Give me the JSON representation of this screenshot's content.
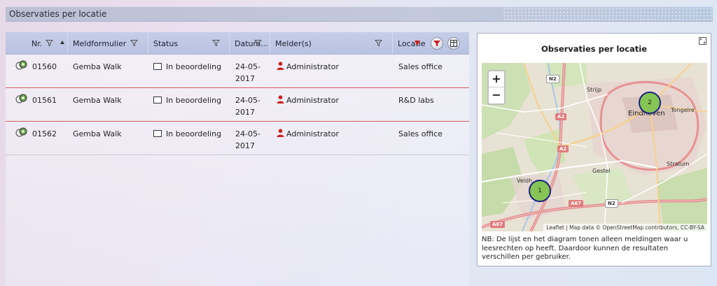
{
  "page": {
    "title": "Observaties per locatie"
  },
  "grid": {
    "columns": {
      "nr": "Nr.",
      "meldformulier": "Meldformulier",
      "status": "Status",
      "datum": "Datum...",
      "melders": "Melder(s)",
      "locatie": "Locatie"
    },
    "rows": [
      {
        "nr": "01560",
        "form": "Gemba Walk",
        "status": "In beoordeling",
        "date1": "24-05-",
        "date2": "2017",
        "reporter": "Administrator",
        "location": "Sales office"
      },
      {
        "nr": "01561",
        "form": "Gemba Walk",
        "status": "In beoordeling",
        "date1": "24-05-",
        "date2": "2017",
        "reporter": "Administrator",
        "location": "R&D labs"
      },
      {
        "nr": "01562",
        "form": "Gemba Walk",
        "status": "In beoordeling",
        "date1": "24-05-",
        "date2": "2017",
        "reporter": "Administrator",
        "location": "Sales office"
      }
    ]
  },
  "panel": {
    "title": "Observaties per locatie",
    "zoom_in": "+",
    "zoom_out": "−",
    "clusters": [
      {
        "count": "2"
      },
      {
        "count": "1"
      }
    ],
    "map_labels": {
      "city": "Eindhoven",
      "strijp": "Strijp",
      "tongelre": "Tongelre",
      "stratum": "Stratum",
      "gestel": "Gestel",
      "veldhoven": "Veldh"
    },
    "road_labels": {
      "n2a": "N2",
      "a2a": "A2",
      "a2b": "A2",
      "a67a": "A67",
      "a67b": "A67",
      "n2b": "N2"
    },
    "attribution": "Leaflet | Map data © OpenStreetMap contributors, CC-BY-SA",
    "note": "NB: De lijst en het diagram tonen alleen meldingen waar u leesrechten op heeft. Daardoor kunnen de resultaten verschillen per gebruiker."
  },
  "colors": {
    "row_divider": "#d45c5c",
    "cluster_fill": "#86c555",
    "cluster_border": "#1a237e",
    "active_filter": "#d01c1c"
  },
  "icons": {
    "row": "observation-icon",
    "filter": "filter-icon",
    "reporter": "person-icon",
    "expand": "expand-icon"
  }
}
